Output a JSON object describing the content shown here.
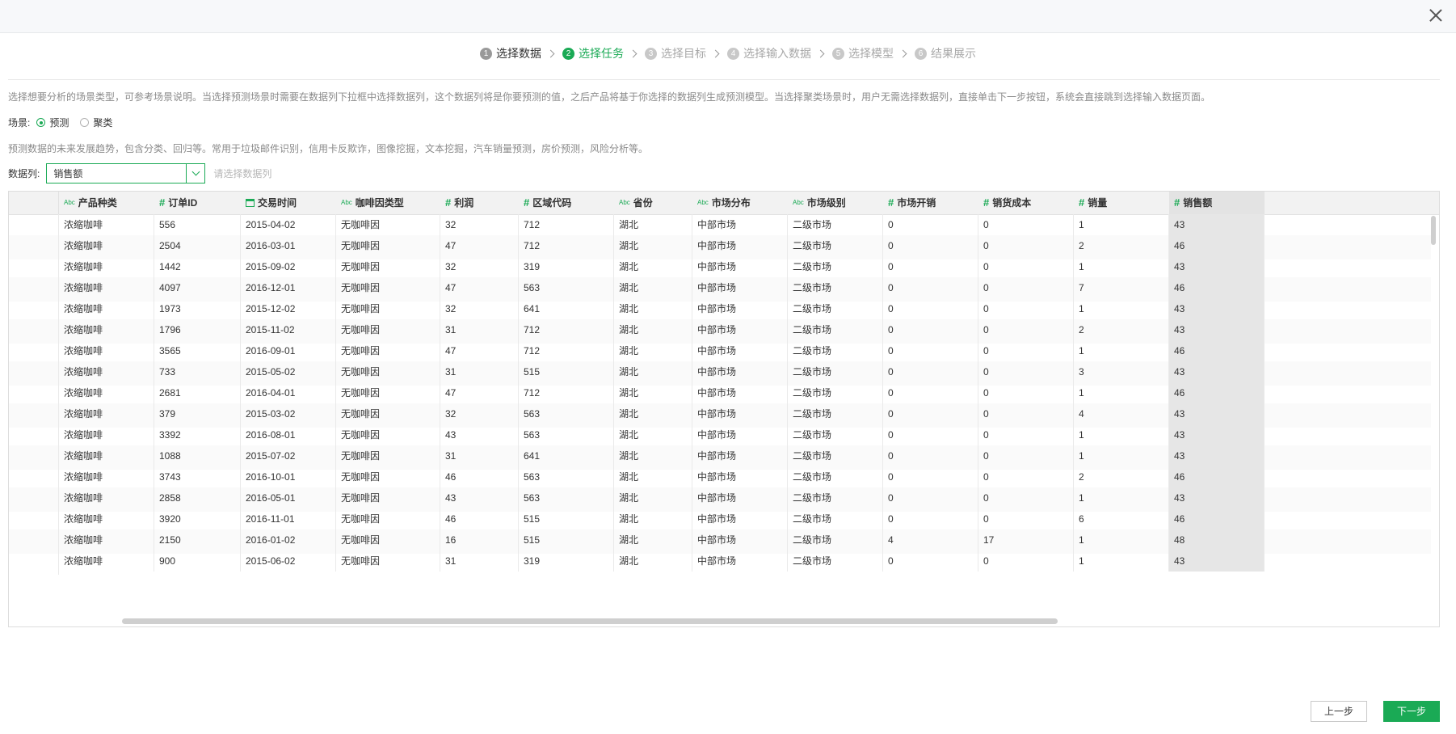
{
  "close_label": "×",
  "steps": [
    {
      "num": "1",
      "label": "选择数据",
      "state": "done"
    },
    {
      "num": "2",
      "label": "选择任务",
      "state": "active"
    },
    {
      "num": "3",
      "label": "选择目标",
      "state": "todo"
    },
    {
      "num": "4",
      "label": "选择输入数据",
      "state": "todo"
    },
    {
      "num": "5",
      "label": "选择模型",
      "state": "todo"
    },
    {
      "num": "6",
      "label": "结果展示",
      "state": "todo"
    }
  ],
  "description": "选择想要分析的场景类型，可参考场景说明。当选择预测场景时需要在数据列下拉框中选择数据列，这个数据列将是你要预测的值，之后产品将基于你选择的数据列生成预测模型。当选择聚类场景时，用户无需选择数据列，直接单击下一步按钮，系统会直接跳到选择输入数据页面。",
  "scene": {
    "label": "场景:",
    "options": [
      {
        "label": "预测",
        "checked": true
      },
      {
        "label": "聚类",
        "checked": false
      }
    ],
    "description": "预测数据的未来发展趋势，包含分类、回归等。常用于垃圾邮件识别，信用卡反欺诈，图像挖掘，文本挖掘，汽车销量预测，房价预测，风险分析等。"
  },
  "data_column": {
    "label": "数据列:",
    "value": "销售额",
    "hint": "请选择数据列"
  },
  "table": {
    "columns": [
      {
        "name": "产品种类",
        "type": "abc"
      },
      {
        "name": "订单ID",
        "type": "num"
      },
      {
        "name": "交易时间",
        "type": "date"
      },
      {
        "name": "咖啡因类型",
        "type": "abc"
      },
      {
        "name": "利润",
        "type": "num"
      },
      {
        "name": "区域代码",
        "type": "num"
      },
      {
        "name": "省份",
        "type": "abc"
      },
      {
        "name": "市场分布",
        "type": "abc"
      },
      {
        "name": "市场级别",
        "type": "abc"
      },
      {
        "name": "市场开销",
        "type": "num"
      },
      {
        "name": "销货成本",
        "type": "num"
      },
      {
        "name": "销量",
        "type": "num"
      },
      {
        "name": "销售额",
        "type": "num"
      }
    ],
    "rows": [
      [
        "浓缩咖啡",
        "556",
        "2015-04-02",
        "无咖啡因",
        "32",
        "712",
        "湖北",
        "中部市场",
        "二级市场",
        "0",
        "0",
        "1",
        "43"
      ],
      [
        "浓缩咖啡",
        "2504",
        "2016-03-01",
        "无咖啡因",
        "47",
        "712",
        "湖北",
        "中部市场",
        "二级市场",
        "0",
        "0",
        "2",
        "46"
      ],
      [
        "浓缩咖啡",
        "1442",
        "2015-09-02",
        "无咖啡因",
        "32",
        "319",
        "湖北",
        "中部市场",
        "二级市场",
        "0",
        "0",
        "1",
        "43"
      ],
      [
        "浓缩咖啡",
        "4097",
        "2016-12-01",
        "无咖啡因",
        "47",
        "563",
        "湖北",
        "中部市场",
        "二级市场",
        "0",
        "0",
        "7",
        "46"
      ],
      [
        "浓缩咖啡",
        "1973",
        "2015-12-02",
        "无咖啡因",
        "32",
        "641",
        "湖北",
        "中部市场",
        "二级市场",
        "0",
        "0",
        "1",
        "43"
      ],
      [
        "浓缩咖啡",
        "1796",
        "2015-11-02",
        "无咖啡因",
        "31",
        "712",
        "湖北",
        "中部市场",
        "二级市场",
        "0",
        "0",
        "2",
        "43"
      ],
      [
        "浓缩咖啡",
        "3565",
        "2016-09-01",
        "无咖啡因",
        "47",
        "712",
        "湖北",
        "中部市场",
        "二级市场",
        "0",
        "0",
        "1",
        "46"
      ],
      [
        "浓缩咖啡",
        "733",
        "2015-05-02",
        "无咖啡因",
        "31",
        "515",
        "湖北",
        "中部市场",
        "二级市场",
        "0",
        "0",
        "3",
        "43"
      ],
      [
        "浓缩咖啡",
        "2681",
        "2016-04-01",
        "无咖啡因",
        "47",
        "712",
        "湖北",
        "中部市场",
        "二级市场",
        "0",
        "0",
        "1",
        "46"
      ],
      [
        "浓缩咖啡",
        "379",
        "2015-03-02",
        "无咖啡因",
        "32",
        "563",
        "湖北",
        "中部市场",
        "二级市场",
        "0",
        "0",
        "4",
        "43"
      ],
      [
        "浓缩咖啡",
        "3392",
        "2016-08-01",
        "无咖啡因",
        "43",
        "563",
        "湖北",
        "中部市场",
        "二级市场",
        "0",
        "0",
        "1",
        "43"
      ],
      [
        "浓缩咖啡",
        "1088",
        "2015-07-02",
        "无咖啡因",
        "31",
        "641",
        "湖北",
        "中部市场",
        "二级市场",
        "0",
        "0",
        "1",
        "43"
      ],
      [
        "浓缩咖啡",
        "3743",
        "2016-10-01",
        "无咖啡因",
        "46",
        "563",
        "湖北",
        "中部市场",
        "二级市场",
        "0",
        "0",
        "2",
        "46"
      ],
      [
        "浓缩咖啡",
        "2858",
        "2016-05-01",
        "无咖啡因",
        "43",
        "563",
        "湖北",
        "中部市场",
        "二级市场",
        "0",
        "0",
        "1",
        "43"
      ],
      [
        "浓缩咖啡",
        "3920",
        "2016-11-01",
        "无咖啡因",
        "46",
        "515",
        "湖北",
        "中部市场",
        "二级市场",
        "0",
        "0",
        "6",
        "46"
      ],
      [
        "浓缩咖啡",
        "2150",
        "2016-01-02",
        "无咖啡因",
        "16",
        "515",
        "湖北",
        "中部市场",
        "二级市场",
        "4",
        "17",
        "1",
        "48"
      ],
      [
        "浓缩咖啡",
        "900",
        "2015-06-02",
        "无咖啡因",
        "31",
        "319",
        "湖北",
        "中部市场",
        "二级市场",
        "0",
        "0",
        "1",
        "43"
      ]
    ]
  },
  "buttons": {
    "prev": "上一步",
    "next": "下一步"
  },
  "colors": {
    "accent": "#1aaa55",
    "header_bg": "#f2f2f2"
  }
}
